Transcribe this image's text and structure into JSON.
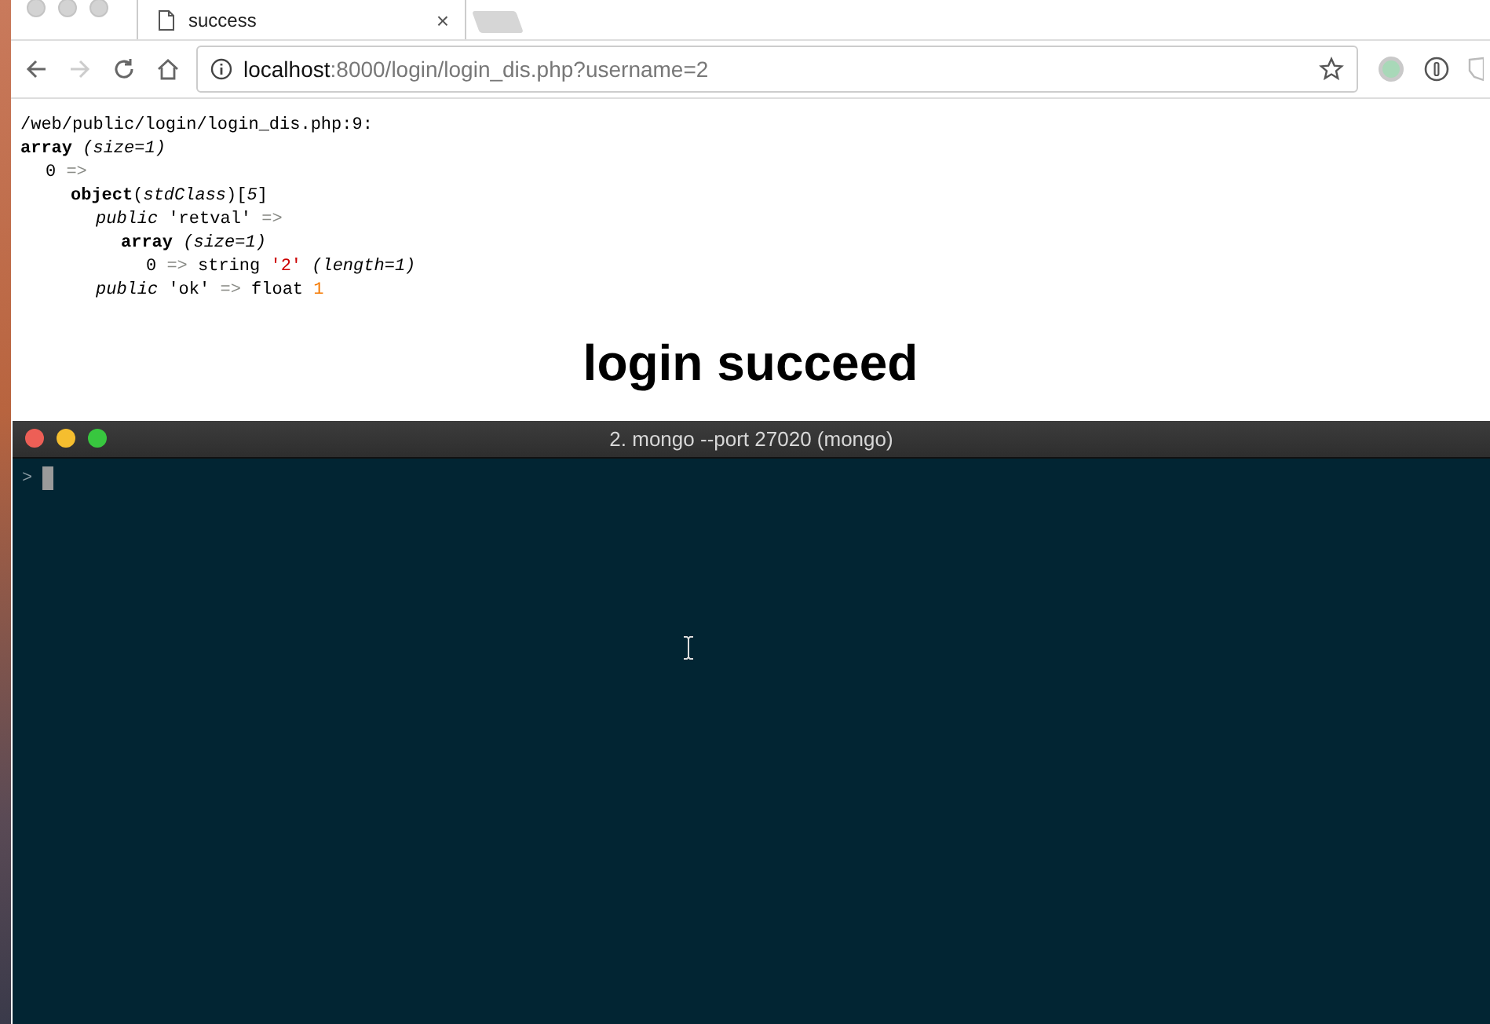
{
  "browser": {
    "tab": {
      "title": "success",
      "close": "×"
    },
    "url": {
      "host": "localhost",
      "rest": ":8000/login/login_dis.php?username=2"
    }
  },
  "dump": [
    {
      "segments": [
        {
          "kind": "plain",
          "text": "/web/public/login/login_dis.php:9:"
        }
      ]
    },
    {
      "segments": [
        {
          "kind": "bold",
          "text": "array"
        },
        {
          "kind": "italic",
          "text": " (size=1)"
        }
      ],
      "children": [
        {
          "segments": [
            {
              "kind": "plain",
              "text": "0 "
            },
            {
              "kind": "op",
              "text": "=>"
            }
          ],
          "children": [
            {
              "segments": [
                {
                  "kind": "bold",
                  "text": "object"
                },
                {
                  "kind": "plain",
                  "text": "("
                },
                {
                  "kind": "italic",
                  "text": "stdClass"
                },
                {
                  "kind": "plain",
                  "text": ")["
                },
                {
                  "kind": "italic",
                  "text": "5"
                },
                {
                  "kind": "plain",
                  "text": "]"
                }
              ],
              "children": [
                {
                  "segments": [
                    {
                      "kind": "italic",
                      "text": "public"
                    },
                    {
                      "kind": "plain",
                      "text": " 'retval' "
                    },
                    {
                      "kind": "op",
                      "text": "=>"
                    }
                  ],
                  "children": [
                    {
                      "segments": [
                        {
                          "kind": "bold",
                          "text": "array"
                        },
                        {
                          "kind": "italic",
                          "text": " (size=1)"
                        }
                      ],
                      "children": [
                        {
                          "segments": [
                            {
                              "kind": "plain",
                              "text": "0 "
                            },
                            {
                              "kind": "op",
                              "text": "=>"
                            },
                            {
                              "kind": "plain",
                              "text": " string "
                            },
                            {
                              "kind": "str",
                              "text": "'2'"
                            },
                            {
                              "kind": "italic",
                              "text": " (length=1)"
                            }
                          ]
                        }
                      ]
                    }
                  ]
                },
                {
                  "segments": [
                    {
                      "kind": "italic",
                      "text": "public"
                    },
                    {
                      "kind": "plain",
                      "text": " 'ok' "
                    },
                    {
                      "kind": "op",
                      "text": "=>"
                    },
                    {
                      "kind": "plain",
                      "text": " float "
                    },
                    {
                      "kind": "num",
                      "text": "1"
                    }
                  ]
                }
              ]
            }
          ]
        }
      ]
    }
  ],
  "heading": "login succeed",
  "terminal": {
    "title": "2. mongo --port 27020 (mongo)",
    "prompt": ">"
  }
}
